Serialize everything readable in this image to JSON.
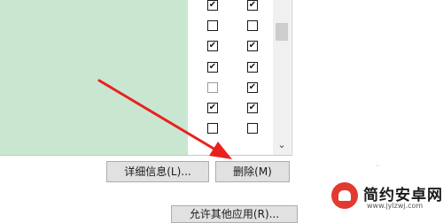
{
  "list": {
    "column_a": [
      true,
      false,
      true,
      true,
      false,
      true,
      false
    ],
    "column_b": [
      true,
      false,
      true,
      true,
      true,
      true,
      false
    ]
  },
  "buttons": {
    "details_label": "详细信息(L)...",
    "delete_label": "删除(M)",
    "bottom_label": "允许其他应用(R)..."
  },
  "scrollbar": {
    "down_icon": "chevron-down-icon"
  },
  "annotation": {
    "arrow_color": "#e8211f"
  },
  "watermark": {
    "title": "简约安卓网",
    "url": "www.jylzwj.com",
    "logo_color": "#e23a2f"
  }
}
